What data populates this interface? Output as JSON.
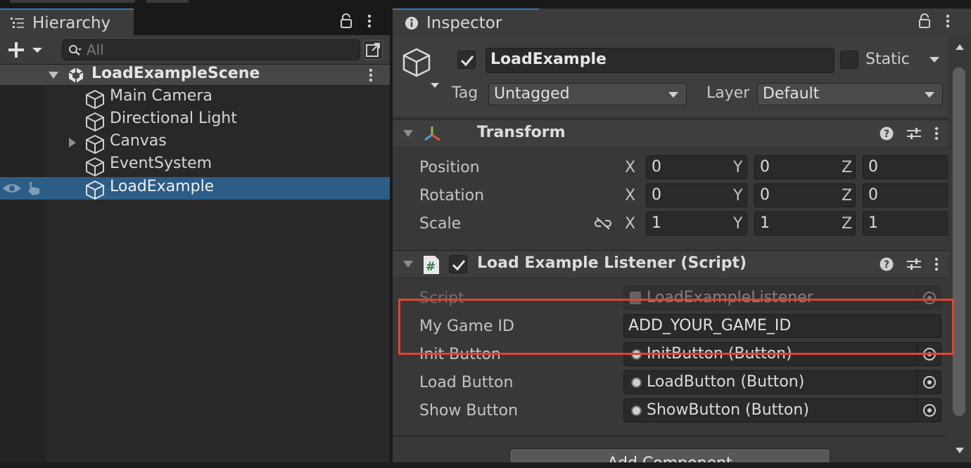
{
  "hierarchy": {
    "tab_label": "Hierarchy",
    "search_placeholder": "All",
    "scene_name": "LoadExampleScene",
    "items": [
      {
        "label": "Main Camera"
      },
      {
        "label": "Directional Light"
      },
      {
        "label": "Canvas"
      },
      {
        "label": "EventSystem"
      },
      {
        "label": "LoadExample"
      }
    ],
    "selected_item": "LoadExample"
  },
  "inspector": {
    "tab_label": "Inspector",
    "object_name": "LoadExample",
    "object_active": true,
    "static_label": "Static",
    "static_checked": false,
    "tag_label": "Tag",
    "tag_value": "Untagged",
    "layer_label": "Layer",
    "layer_value": "Default",
    "transform": {
      "title": "Transform",
      "position_label": "Position",
      "rotation_label": "Rotation",
      "scale_label": "Scale",
      "position": {
        "x": "0",
        "y": "0",
        "z": "0"
      },
      "rotation": {
        "x": "0",
        "y": "0",
        "z": "0"
      },
      "scale": {
        "x": "1",
        "y": "1",
        "z": "1"
      },
      "axis_x": "X",
      "axis_y": "Y",
      "axis_z": "Z"
    },
    "script_component": {
      "title": "Load Example Listener (Script)",
      "enabled": true,
      "script_label": "Script",
      "script_value": "LoadExampleListener",
      "game_id_label": "My Game ID",
      "game_id_value": "ADD_YOUR_GAME_ID",
      "init_label": "Init Button",
      "init_value": "InitButton (Button)",
      "load_label": "Load Button",
      "load_value": "LoadButton (Button)",
      "show_label": "Show Button",
      "show_value": "ShowButton (Button)"
    },
    "add_component_label": "Add Component"
  },
  "colors": {
    "accent": "#2c5d87",
    "highlight": "#e1442e",
    "tab_top": "#3a79bb"
  }
}
